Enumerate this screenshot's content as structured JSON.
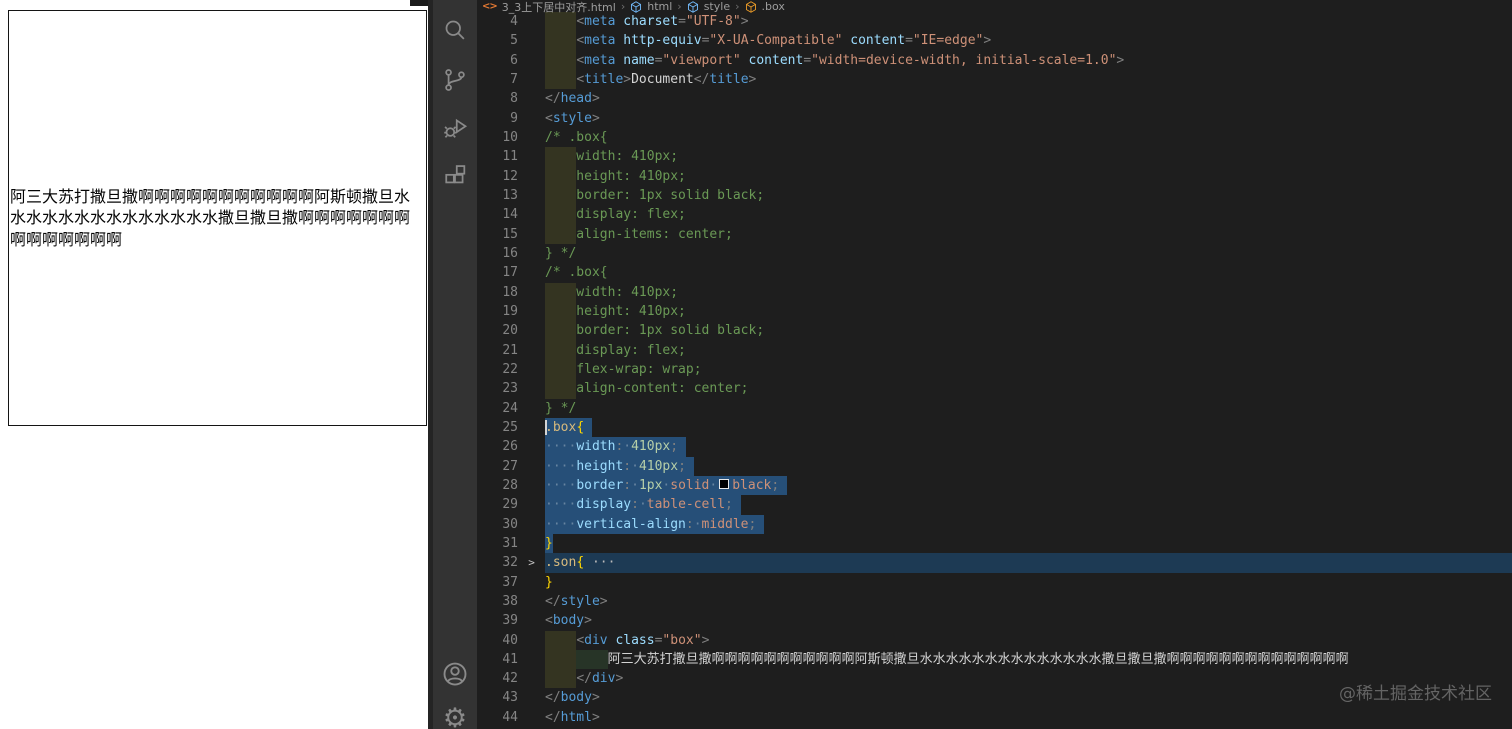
{
  "preview": {
    "box_text": "阿三大苏打撒旦撒啊啊啊啊啊啊啊啊啊啊啊阿斯顿撒旦水水水水水水水水水水水水水水撒旦撒旦撒啊啊啊啊啊啊啊啊啊啊啊啊啊啊"
  },
  "activity_bar": {
    "icons": [
      "search",
      "source-control",
      "run-and-debug",
      "extensions",
      "account",
      "settings"
    ]
  },
  "breadcrumb": {
    "file": "3_3上下居中对齐.html",
    "separator": "›",
    "segments": [
      "html",
      "style",
      ".box"
    ]
  },
  "colors": {
    "editor_background": "#1e1e1e",
    "activity_bar_background": "#333333",
    "selection": "#264f78",
    "folded_line_highlight": "#1d3a54",
    "comment": "#6a9955",
    "tag": "#569cd6",
    "string": "#ce9178",
    "number": "#b5cea8",
    "property": "#9cdcfe",
    "selector": "#d7ba7d",
    "brace": "#ffd700"
  },
  "watermark": "@稀土掘金技术社区",
  "editor": {
    "lines": [
      {
        "n": "4",
        "bands": 1,
        "tokens": [
          [
            "text",
            "    "
          ],
          [
            "punct",
            "<"
          ],
          [
            "tag",
            "meta"
          ],
          [
            "text",
            " "
          ],
          [
            "attr",
            "charset"
          ],
          [
            "punct",
            "="
          ],
          [
            "str",
            "\"UTF-8\""
          ],
          [
            "punct",
            ">"
          ]
        ]
      },
      {
        "n": "5",
        "bands": 1,
        "tokens": [
          [
            "text",
            "    "
          ],
          [
            "punct",
            "<"
          ],
          [
            "tag",
            "meta"
          ],
          [
            "text",
            " "
          ],
          [
            "attr",
            "http-equiv"
          ],
          [
            "punct",
            "="
          ],
          [
            "str",
            "\"X-UA-Compatible\""
          ],
          [
            "text",
            " "
          ],
          [
            "attr",
            "content"
          ],
          [
            "punct",
            "="
          ],
          [
            "str",
            "\"IE=edge\""
          ],
          [
            "punct",
            ">"
          ]
        ]
      },
      {
        "n": "6",
        "bands": 1,
        "tokens": [
          [
            "text",
            "    "
          ],
          [
            "punct",
            "<"
          ],
          [
            "tag",
            "meta"
          ],
          [
            "text",
            " "
          ],
          [
            "attr",
            "name"
          ],
          [
            "punct",
            "="
          ],
          [
            "str",
            "\"viewport\""
          ],
          [
            "text",
            " "
          ],
          [
            "attr",
            "content"
          ],
          [
            "punct",
            "="
          ],
          [
            "str",
            "\"width=device-width, initial-scale=1.0\""
          ],
          [
            "punct",
            ">"
          ]
        ]
      },
      {
        "n": "7",
        "bands": 1,
        "tokens": [
          [
            "text",
            "    "
          ],
          [
            "punct",
            "<"
          ],
          [
            "tag",
            "title"
          ],
          [
            "punct",
            ">"
          ],
          [
            "text",
            "Document"
          ],
          [
            "punct",
            "</"
          ],
          [
            "tag",
            "title"
          ],
          [
            "punct",
            ">"
          ]
        ]
      },
      {
        "n": "8",
        "tokens": [
          [
            "punct",
            "</"
          ],
          [
            "tag",
            "head"
          ],
          [
            "punct",
            ">"
          ]
        ]
      },
      {
        "n": "9",
        "tokens": [
          [
            "punct",
            "<"
          ],
          [
            "tag",
            "style"
          ],
          [
            "punct",
            ">"
          ]
        ]
      },
      {
        "n": "10",
        "tokens": [
          [
            "comment",
            "/* .box{"
          ]
        ]
      },
      {
        "n": "11",
        "bands": 1,
        "tokens": [
          [
            "comment",
            "    width: 410px;"
          ]
        ]
      },
      {
        "n": "12",
        "bands": 1,
        "tokens": [
          [
            "comment",
            "    height: 410px;"
          ]
        ]
      },
      {
        "n": "13",
        "bands": 1,
        "tokens": [
          [
            "comment",
            "    border: 1px solid black;"
          ]
        ]
      },
      {
        "n": "14",
        "bands": 1,
        "tokens": [
          [
            "comment",
            "    display: flex;"
          ]
        ]
      },
      {
        "n": "15",
        "bands": 1,
        "tokens": [
          [
            "comment",
            "    align-items: center;"
          ]
        ]
      },
      {
        "n": "16",
        "tokens": [
          [
            "comment",
            "} */"
          ]
        ]
      },
      {
        "n": "17",
        "tokens": [
          [
            "comment",
            "/* .box{"
          ]
        ]
      },
      {
        "n": "18",
        "bands": 1,
        "tokens": [
          [
            "comment",
            "    width: 410px;"
          ]
        ]
      },
      {
        "n": "19",
        "bands": 1,
        "tokens": [
          [
            "comment",
            "    height: 410px;"
          ]
        ]
      },
      {
        "n": "20",
        "bands": 1,
        "tokens": [
          [
            "comment",
            "    border: 1px solid black;"
          ]
        ]
      },
      {
        "n": "21",
        "bands": 1,
        "tokens": [
          [
            "comment",
            "    display: flex;"
          ]
        ]
      },
      {
        "n": "22",
        "bands": 1,
        "tokens": [
          [
            "comment",
            "    flex-wrap: wrap;"
          ]
        ]
      },
      {
        "n": "23",
        "bands": 1,
        "tokens": [
          [
            "comment",
            "    align-content: center;"
          ]
        ]
      },
      {
        "n": "24",
        "tokens": [
          [
            "comment",
            "} */"
          ]
        ]
      },
      {
        "n": "25",
        "sel": true,
        "selnl": true,
        "caret": true,
        "tokens": [
          [
            "selector",
            ".box"
          ],
          [
            "brace",
            "{"
          ]
        ]
      },
      {
        "n": "26",
        "bands": 1,
        "sel": true,
        "selnl": true,
        "tokens": [
          [
            "ws",
            "····"
          ],
          [
            "prop",
            "width"
          ],
          [
            "punct",
            ":"
          ],
          [
            "ws",
            "·"
          ],
          [
            "num",
            "410px"
          ],
          [
            "punct",
            ";"
          ]
        ]
      },
      {
        "n": "27",
        "bands": 1,
        "sel": true,
        "selnl": true,
        "tokens": [
          [
            "ws",
            "····"
          ],
          [
            "prop",
            "height"
          ],
          [
            "punct",
            ":"
          ],
          [
            "ws",
            "·"
          ],
          [
            "num",
            "410px"
          ],
          [
            "punct",
            ";"
          ]
        ]
      },
      {
        "n": "28",
        "bands": 1,
        "sel": true,
        "selnl": true,
        "tokens": [
          [
            "ws",
            "····"
          ],
          [
            "prop",
            "border"
          ],
          [
            "punct",
            ":"
          ],
          [
            "ws",
            "·"
          ],
          [
            "num",
            "1px"
          ],
          [
            "ws",
            "·"
          ],
          [
            "val",
            "solid"
          ],
          [
            "ws",
            "·"
          ],
          [
            "swatch",
            ""
          ],
          [
            "val",
            "black"
          ],
          [
            "punct",
            ";"
          ]
        ]
      },
      {
        "n": "29",
        "bands": 1,
        "sel": true,
        "selnl": true,
        "tokens": [
          [
            "ws",
            "····"
          ],
          [
            "prop",
            "display"
          ],
          [
            "punct",
            ":"
          ],
          [
            "ws",
            "·"
          ],
          [
            "val",
            "table-cell"
          ],
          [
            "punct",
            ";"
          ]
        ]
      },
      {
        "n": "30",
        "bands": 1,
        "sel": true,
        "selnl": true,
        "tokens": [
          [
            "ws",
            "····"
          ],
          [
            "prop",
            "vertical-align"
          ],
          [
            "punct",
            ":"
          ],
          [
            "ws",
            "·"
          ],
          [
            "val",
            "middle"
          ],
          [
            "punct",
            ";"
          ]
        ]
      },
      {
        "n": "31",
        "sel": true,
        "tokens": [
          [
            "brace",
            "}"
          ]
        ]
      },
      {
        "n": "32",
        "hl": true,
        "fold": true,
        "tokens": [
          [
            "selector",
            ".son"
          ],
          [
            "brace",
            "{"
          ],
          [
            "text",
            " "
          ],
          [
            "fold",
            "···"
          ]
        ]
      },
      {
        "n": "37",
        "tokens": [
          [
            "brace",
            "}"
          ]
        ]
      },
      {
        "n": "38",
        "tokens": [
          [
            "punct",
            "</"
          ],
          [
            "tag",
            "style"
          ],
          [
            "punct",
            ">"
          ]
        ]
      },
      {
        "n": "39",
        "tokens": [
          [
            "punct",
            "<"
          ],
          [
            "tag",
            "body"
          ],
          [
            "punct",
            ">"
          ]
        ]
      },
      {
        "n": "40",
        "bands": 1,
        "tokens": [
          [
            "text",
            "    "
          ],
          [
            "punct",
            "<"
          ],
          [
            "tag",
            "div"
          ],
          [
            "text",
            " "
          ],
          [
            "attr",
            "class"
          ],
          [
            "punct",
            "="
          ],
          [
            "str",
            "\"box\""
          ],
          [
            "punct",
            ">"
          ]
        ]
      },
      {
        "n": "41",
        "bands": 2,
        "tokens": [
          [
            "text",
            "        "
          ],
          [
            "text",
            "阿三大苏打撒旦撒啊啊啊啊啊啊啊啊啊啊啊阿斯顿撒旦水水水水水水水水水水水水水水撒旦撒旦撒啊啊啊啊啊啊啊啊啊啊啊啊啊啊"
          ]
        ]
      },
      {
        "n": "42",
        "bands": 1,
        "tokens": [
          [
            "text",
            "    "
          ],
          [
            "punct",
            "</"
          ],
          [
            "tag",
            "div"
          ],
          [
            "punct",
            ">"
          ]
        ]
      },
      {
        "n": "43",
        "tokens": [
          [
            "punct",
            "</"
          ],
          [
            "tag",
            "body"
          ],
          [
            "punct",
            ">"
          ]
        ]
      },
      {
        "n": "44",
        "tokens": [
          [
            "punct",
            "</"
          ],
          [
            "tag",
            "html"
          ],
          [
            "punct",
            ">"
          ]
        ]
      }
    ]
  }
}
